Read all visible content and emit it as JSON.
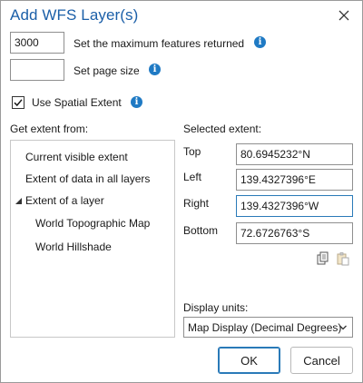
{
  "dialog": {
    "title": "Add WFS Layer(s)"
  },
  "max_features": {
    "value": "3000",
    "label": "Set the maximum features returned"
  },
  "page_size": {
    "value": "",
    "label": "Set page size"
  },
  "spatial_extent": {
    "checked": true,
    "label": "Use Spatial Extent"
  },
  "extent_source": {
    "heading": "Get extent from:",
    "items": [
      {
        "label": "Current visible extent"
      },
      {
        "label": "Extent of data in all layers"
      },
      {
        "label": "Extent of a layer",
        "expanded": true,
        "children": [
          {
            "label": "World Topographic Map"
          },
          {
            "label": "World Hillshade"
          }
        ]
      }
    ]
  },
  "selected_extent": {
    "heading": "Selected extent:",
    "top": {
      "label": "Top",
      "value": "80.6945232°N"
    },
    "left": {
      "label": "Left",
      "value": "139.4327396°E"
    },
    "right": {
      "label": "Right",
      "value": "139.4327396°W"
    },
    "bottom": {
      "label": "Bottom",
      "value": "72.6726763°S"
    }
  },
  "display_units": {
    "label": "Display units:",
    "selected": "Map Display (Decimal Degrees)"
  },
  "buttons": {
    "ok": "OK",
    "cancel": "Cancel"
  },
  "colors": {
    "title": "#1b5fa8",
    "accent": "#1f7ac4",
    "focus_border": "#2a7ab8"
  },
  "icons": [
    "close-icon",
    "info-icon",
    "checkmark-icon",
    "expand-triangle-icon",
    "copy-icon",
    "paste-icon",
    "chevron-down-icon"
  ]
}
